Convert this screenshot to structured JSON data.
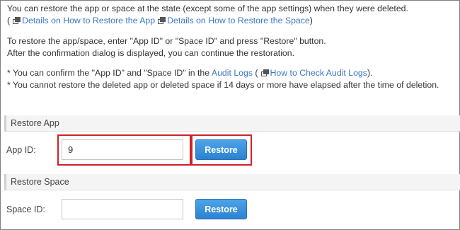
{
  "intro": {
    "line1": "You can restore the app or space at the state (except some of the app settings) when they were deleted.",
    "line2_prefix": "(",
    "link_restore_app": "Details on How to Restore the App",
    "link_restore_space": "Details on How to Restore the Space",
    "line2_suffix": ")",
    "line3": "To restore the app/space, enter \"App ID\" or \"Space ID\" and press \"Restore\" button.",
    "line4": "After the confirmation dialog is displayed, you can continue the restoration.",
    "note1_prefix": "* You can confirm the \"App ID\" and \"Space ID\" in the",
    "link_audit_logs": "Audit Logs",
    "note1_mid": "(",
    "link_check_audit_logs": "How to Check Audit Logs",
    "note1_suffix": ").",
    "note2": "* You cannot restore the deleted app or deleted space if 14 days or more have elapsed after the time of deletion."
  },
  "restore_app": {
    "header": "Restore App",
    "label": "App ID:",
    "value": "9",
    "button": "Restore"
  },
  "restore_space": {
    "header": "Restore Space",
    "label": "Space ID:",
    "value": "",
    "button": "Restore"
  },
  "icons": {
    "external_link": "external-link-icon"
  },
  "colors": {
    "link": "#3a78c3",
    "button": "#2b82d0",
    "highlight": "#d0202a"
  }
}
